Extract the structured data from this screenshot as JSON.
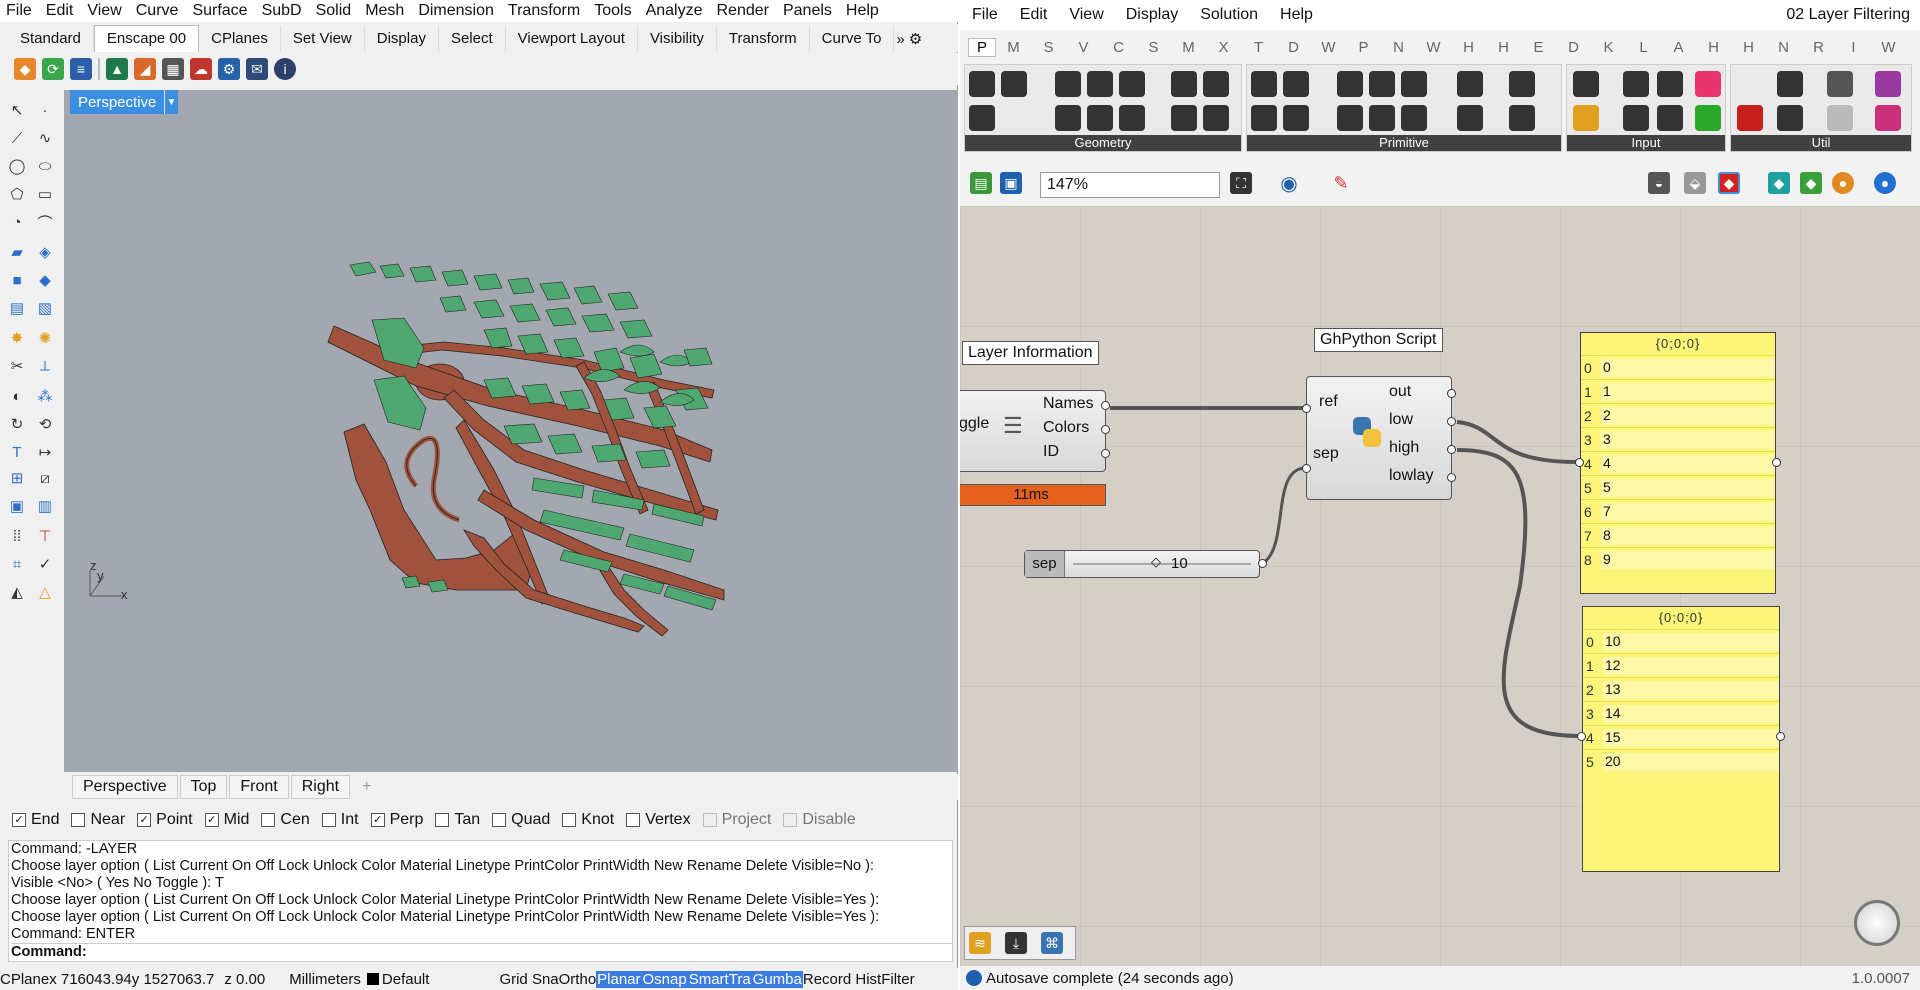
{
  "rhino": {
    "menu": [
      "File",
      "Edit",
      "View",
      "Curve",
      "Surface",
      "SubD",
      "Solid",
      "Mesh",
      "Dimension",
      "Transform",
      "Tools",
      "Analyze",
      "Render",
      "Panels",
      "Help"
    ],
    "tabs": [
      "Standard",
      "Enscape 00",
      "CPlanes",
      "Set View",
      "Display",
      "Select",
      "Viewport Layout",
      "Visibility",
      "Transform",
      "Curve To"
    ],
    "active_tab": "Enscape 00",
    "viewport_label": "Perspective",
    "viewport_tabs": [
      "Perspective",
      "Top",
      "Front",
      "Right"
    ],
    "viewport_add": "+",
    "axis": {
      "x": "x",
      "y": "y",
      "z": "z"
    },
    "snaps": [
      {
        "label": "End",
        "checked": true
      },
      {
        "label": "Near",
        "checked": false
      },
      {
        "label": "Point",
        "checked": true
      },
      {
        "label": "Mid",
        "checked": true
      },
      {
        "label": "Cen",
        "checked": false
      },
      {
        "label": "Int",
        "checked": false
      },
      {
        "label": "Perp",
        "checked": true
      },
      {
        "label": "Tan",
        "checked": false
      },
      {
        "label": "Quad",
        "checked": false
      },
      {
        "label": "Knot",
        "checked": false
      },
      {
        "label": "Vertex",
        "checked": false
      },
      {
        "label": "Project",
        "checked": false,
        "disabled": true
      },
      {
        "label": "Disable",
        "checked": false,
        "disabled": true
      }
    ],
    "command_history": [
      "Command: -LAYER",
      "Choose layer option ( List  Current  On  Off  Lock  Unlock  Color  Material  Linetype  PrintColor  PrintWidth  New  Rename  Delete  Visible=No ):",
      "Visible <No> ( Yes  No  Toggle ): T",
      "Choose layer option ( List  Current  On  Off  Lock  Unlock  Color  Material  Linetype  PrintColor  PrintWidth  New  Rename  Delete  Visible=Yes ):",
      "Choose layer option ( List  Current  On  Off  Lock  Unlock  Color  Material  Linetype  PrintColor  PrintWidth  New  Rename  Delete  Visible=Yes ):",
      "Command: ENTER"
    ],
    "command_prompt": "Command:",
    "status": {
      "cplane": "CPlane",
      "x": "x 716043.94",
      "y": "y 1527063.7",
      "z": "z 0.00",
      "units": "Millimeters",
      "layer": "Default",
      "grid_snap": "Grid Sna",
      "ortho": "Ortho",
      "planar": "Planar",
      "osnap": "Osnap",
      "smarttrack": "SmartTra",
      "gumball": "Gumba",
      "record": "Record Hist",
      "filter": "Filter"
    }
  },
  "gh": {
    "menu": [
      "File",
      "Edit",
      "View",
      "Display",
      "Solution",
      "Help"
    ],
    "title": "02 Layer Filtering",
    "category_tabs": [
      "P",
      "M",
      "S",
      "V",
      "C",
      "S",
      "M",
      "X",
      "T",
      "D",
      "W",
      "P",
      "N",
      "W",
      "H",
      "H",
      "E",
      "D",
      "K",
      "L",
      "A",
      "H",
      "H",
      "N",
      "R",
      "I",
      "W"
    ],
    "ribbon_groups": [
      "Geometry",
      "Primitive",
      "Input",
      "Util"
    ],
    "zoom": "147%",
    "layer_node": {
      "title": "Layer Information",
      "left_label": "ggle",
      "outputs": [
        "Names",
        "Colors",
        "ID"
      ],
      "timing": "11ms"
    },
    "python_node": {
      "title": "GhPython Script",
      "inputs": [
        "ref",
        "sep"
      ],
      "outputs": [
        "out",
        "low",
        "high",
        "lowlay"
      ]
    },
    "slider": {
      "label": "sep",
      "value": "10"
    },
    "panel_low": {
      "path": "{0;0;0}",
      "rows": [
        {
          "i": "0",
          "v": "0"
        },
        {
          "i": "1",
          "v": "1"
        },
        {
          "i": "2",
          "v": "2"
        },
        {
          "i": "3",
          "v": "3"
        },
        {
          "i": "4",
          "v": "4"
        },
        {
          "i": "5",
          "v": "5"
        },
        {
          "i": "6",
          "v": "7"
        },
        {
          "i": "7",
          "v": "8"
        },
        {
          "i": "8",
          "v": "9"
        }
      ]
    },
    "panel_high": {
      "path": "{0;0;0}",
      "rows": [
        {
          "i": "0",
          "v": "10"
        },
        {
          "i": "1",
          "v": "12"
        },
        {
          "i": "2",
          "v": "13"
        },
        {
          "i": "3",
          "v": "14"
        },
        {
          "i": "4",
          "v": "15"
        },
        {
          "i": "5",
          "v": "20"
        }
      ]
    },
    "status": "Autosave complete (24 seconds ago)",
    "version": "1.0.0007"
  },
  "colors": {
    "viewport_bg": "#a3a8b0",
    "road": "#a0523d",
    "building": "#4fa872",
    "panel_yellow": "#fbf57a",
    "timing_orange": "#e4621e",
    "selection_blue": "#3b8fe0"
  }
}
